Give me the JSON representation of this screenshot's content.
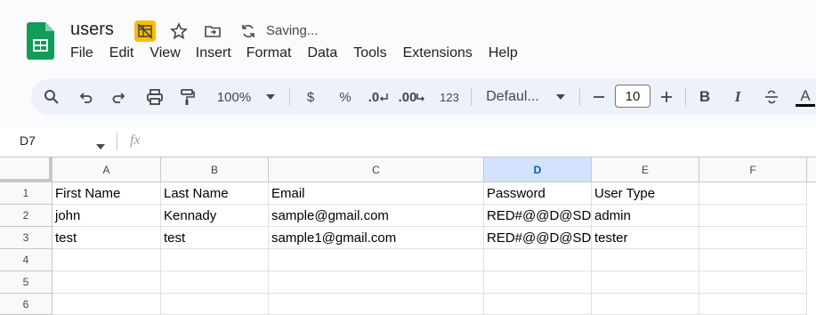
{
  "doc": {
    "title": "users",
    "saving": "Saving..."
  },
  "menu": [
    "File",
    "Edit",
    "View",
    "Insert",
    "Format",
    "Data",
    "Tools",
    "Extensions",
    "Help"
  ],
  "toolbar": {
    "zoom": "100%",
    "currency": "$",
    "percent": "%",
    "dec_decrease": ".0",
    "dec_increase": ".00",
    "number_format": "123",
    "font": "Defaul...",
    "font_size": "10",
    "bold": "B",
    "italic": "I",
    "text_color": "A"
  },
  "formula": {
    "cell_ref": "D7",
    "fx": "fx"
  },
  "columns": [
    "A",
    "B",
    "C",
    "D",
    "E",
    "F"
  ],
  "selected_column": "D",
  "rows": [
    {
      "num": "1",
      "cells": [
        "First Name",
        "Last Name",
        "Email",
        "Password",
        "User Type",
        ""
      ]
    },
    {
      "num": "2",
      "cells": [
        "john",
        "Kennady",
        "sample@gmail.com",
        "RED#@@D@SD",
        "admin",
        ""
      ]
    },
    {
      "num": "3",
      "cells": [
        "test",
        "test",
        "sample1@gmail.com",
        "RED#@@D@SD",
        "tester",
        ""
      ]
    },
    {
      "num": "4",
      "cells": [
        "",
        "",
        "",
        "",
        "",
        ""
      ]
    },
    {
      "num": "5",
      "cells": [
        "",
        "",
        "",
        "",
        "",
        ""
      ]
    },
    {
      "num": "6",
      "cells": [
        "",
        "",
        "",
        "",
        "",
        ""
      ]
    }
  ],
  "colors": {
    "accent": "#0b57d0",
    "sheets_green": "#0f9d58",
    "badge_yellow": "#fbbc04"
  }
}
